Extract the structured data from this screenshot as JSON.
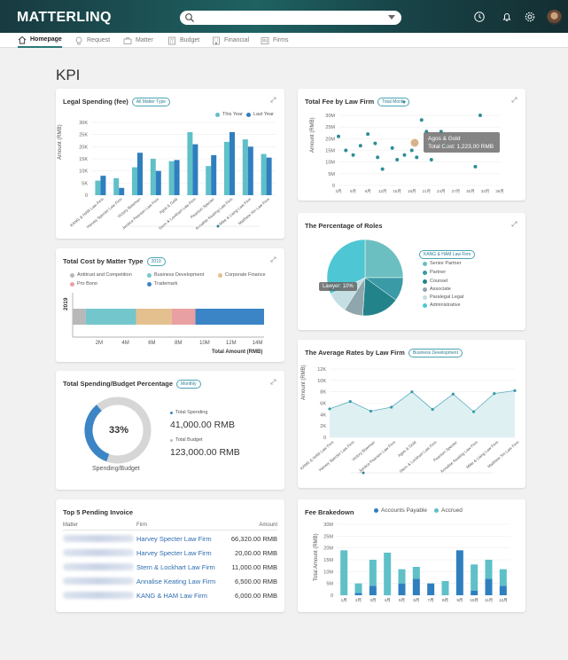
{
  "app": {
    "logo": "MATTERLINQ"
  },
  "search": {
    "placeholder": ""
  },
  "nav": [
    {
      "label": "Homepage",
      "icon": "home-icon"
    },
    {
      "label": "Request",
      "icon": "lightbulb-icon"
    },
    {
      "label": "Matter",
      "icon": "briefcase-icon"
    },
    {
      "label": "Budget",
      "icon": "calculator-icon"
    },
    {
      "label": "Financial",
      "icon": "building-icon"
    },
    {
      "label": "Firms",
      "icon": "contacts-icon"
    }
  ],
  "page_title": "KPI",
  "legal_spending": {
    "title": "Legal Spending (fee)",
    "filter": "All Matter Type",
    "legend": [
      "This Year",
      "Last Year"
    ],
    "ylabel": "Amount (RMB)",
    "colors": {
      "this_year": "#5fc0c8",
      "last_year": "#2f7fbf"
    }
  },
  "total_fee": {
    "title": "Total Fee by Law Firm",
    "filter": "Total Month",
    "ylabel": "Amount (RMB)",
    "tooltip_name": "Agos & Gold",
    "tooltip_value": "Total Cost: 1,223,00 RMB"
  },
  "cost_matter": {
    "title": "Total Cost by Matter Type",
    "filter": "2019",
    "legend": [
      "Antitrust and Competition",
      "Business Development",
      "Corporate Finance",
      "Pro Bono",
      "Trademark"
    ],
    "year_label": "2019",
    "xlabel": "Total Amount (RMB)"
  },
  "roles": {
    "title": "The Percentage of Roles",
    "filter": "KANG & HAM Law Firm",
    "legend": [
      "Senior Partner",
      "Partner",
      "Counsel",
      "Associate",
      "Paralegal Legal",
      "Administrative"
    ],
    "tooltip": "Lawyer: 10%"
  },
  "spending_budget": {
    "title": "Total Spending/Budget Percentage",
    "filter": "Monthly",
    "percent": "33%",
    "caption": "Spending/Budget",
    "spending_label": "Total Spending",
    "spending_value": "41,000.00 RMB",
    "budget_label": "Total Budget",
    "budget_value": "123,000.00 RMB"
  },
  "avg_rates": {
    "title": "The Average Rates by Law Firm",
    "filter": "Business Development",
    "ylabel": "Amount (RMB)"
  },
  "invoice": {
    "title": "Top 5 Pending Invoice",
    "headers": {
      "matter": "Matter",
      "firm": "Firm",
      "amount": "Amount"
    },
    "rows": [
      {
        "firm": "Harvey Specter Law Firm",
        "amount": "66,320.00 RMB"
      },
      {
        "firm": "Harvey Specter Law Firm",
        "amount": "20,00.00 RMB"
      },
      {
        "firm": "Stern & Lockhart Law Firm",
        "amount": "11,000.00 RMB"
      },
      {
        "firm": "Annalise Keating Law Firm",
        "amount": "6,500.00 RMB"
      },
      {
        "firm": "KANG & HAM Law Firm",
        "amount": "6,000.00 RMB"
      }
    ]
  },
  "fee_breakdown": {
    "title": "Fee Brakedown",
    "legend": [
      "Accounts Payable",
      "Accrued"
    ],
    "ylabel": "Total Amount (RMB)"
  },
  "chart_data": [
    {
      "type": "bar",
      "id": "legal_spending",
      "categories": [
        "KANG & HAM Law Firm",
        "Harvey Specter Law Firm",
        "Victory Bowman",
        "Jessica Pearson Law Firm",
        "Agos & Gold",
        "Stern & Lockhart Law Firm",
        "Pearson Specter",
        "Annalise Keating Law Firm",
        "Mike & Liang Law Firm",
        "Matthew Xin Law Firm"
      ],
      "series": [
        {
          "name": "This Year",
          "values": [
            6,
            7,
            11.5,
            15,
            14,
            26,
            12,
            22,
            23,
            17
          ]
        },
        {
          "name": "Last Year",
          "values": [
            8,
            3,
            17.5,
            10,
            14.5,
            21,
            16.5,
            26,
            20,
            15.5
          ]
        }
      ],
      "yticks": [
        "0",
        "5K",
        "10K",
        "15K",
        "20K",
        "25K",
        "30K"
      ],
      "ylim": [
        0,
        30
      ]
    },
    {
      "type": "scatter",
      "id": "total_fee",
      "xticks": [
        "3月",
        "6月",
        "9月",
        "12月",
        "15月",
        "18月",
        "21月",
        "24月",
        "27月",
        "30月",
        "33月",
        "36月"
      ],
      "yticks": [
        "0",
        "5M",
        "10M",
        "15M",
        "20M",
        "25M",
        "30M"
      ],
      "points": [
        [
          3,
          21
        ],
        [
          4.5,
          15
        ],
        [
          6,
          13
        ],
        [
          7.5,
          17
        ],
        [
          9,
          22
        ],
        [
          10.5,
          18
        ],
        [
          11,
          12
        ],
        [
          12,
          7
        ],
        [
          14,
          16
        ],
        [
          15,
          11
        ],
        [
          16.5,
          13
        ],
        [
          18,
          15
        ],
        [
          19,
          12
        ],
        [
          20,
          28
        ],
        [
          21,
          23
        ],
        [
          22,
          11
        ],
        [
          24,
          23
        ],
        [
          25,
          17
        ],
        [
          31,
          8
        ],
        [
          32,
          30
        ]
      ]
    },
    {
      "type": "bar",
      "id": "cost_matter",
      "orientation": "horizontal",
      "category": "2019",
      "xticks": [
        "2M",
        "4M",
        "6M",
        "8M",
        "10M",
        "12M",
        "14M"
      ],
      "segments": [
        {
          "name": "Antitrust and Competition",
          "value": 1,
          "color": "#b8b8b8"
        },
        {
          "name": "Business Development",
          "value": 3.8,
          "color": "#73c7cc"
        },
        {
          "name": "Corporate Finance",
          "value": 2.7,
          "color": "#e3c08e"
        },
        {
          "name": "Pro Bono",
          "value": 1.8,
          "color": "#e9a0a3"
        },
        {
          "name": "Trademark",
          "value": 5.2,
          "color": "#3b85c6"
        }
      ]
    },
    {
      "type": "pie",
      "id": "roles",
      "slices": [
        {
          "name": "Senior Partner",
          "value": 25,
          "color": "#6cbfc0"
        },
        {
          "name": "Partner",
          "value": 10,
          "color": "#3a9aa6"
        },
        {
          "name": "Counsel",
          "value": 16,
          "color": "#23838b"
        },
        {
          "name": "Associate",
          "value": 8,
          "color": "#8fa6ad"
        },
        {
          "name": "Paralegal Legal",
          "value": 9,
          "color": "#c3dfe3"
        },
        {
          "name": "Administrative",
          "value": 32,
          "color": "#4fc6d3"
        }
      ]
    },
    {
      "type": "pie",
      "id": "spending_budget",
      "slices": [
        {
          "name": "Total Spending",
          "value": 41000,
          "color": "#3b85c6"
        },
        {
          "name": "Remaining",
          "value": 82000,
          "color": "#d6d6d6"
        }
      ]
    },
    {
      "type": "area",
      "id": "avg_rates",
      "categories": [
        "KANG & HAM Law Firm",
        "Harvey Specter Law Firm",
        "Victory Bowman",
        "Jessica Pearson Law Firm",
        "Agos & Gold",
        "Stern & Lockhart Law Firm",
        "Pearson Specter",
        "Annalise Keating Law Firm",
        "Mike & Liang Law Firm",
        "Matthew Xin Law Firm"
      ],
      "values": [
        5000,
        6300,
        4600,
        5300,
        8000,
        4900,
        7600,
        4500,
        7700,
        8200
      ],
      "yticks": [
        "0",
        "2K",
        "4K",
        "6K",
        "8K",
        "10K",
        "12K"
      ],
      "ylim": [
        0,
        12000
      ]
    },
    {
      "type": "bar",
      "id": "fee_breakdown",
      "stacked": true,
      "categories": [
        "1月",
        "2月",
        "3月",
        "4月",
        "5月",
        "6月",
        "7月",
        "8月",
        "9月",
        "10月",
        "11月",
        "12月"
      ],
      "yticks": [
        "0",
        "5M",
        "10M",
        "15M",
        "20M",
        "25M",
        "30M"
      ],
      "series": [
        {
          "name": "Accounts Payable",
          "values": [
            0,
            1,
            4,
            0,
            5,
            7,
            5,
            0,
            19,
            2,
            7,
            4
          ]
        },
        {
          "name": "Accrued",
          "values": [
            19,
            4,
            11,
            18,
            6,
            5,
            0,
            6,
            0,
            11,
            8,
            7
          ]
        }
      ],
      "ylim": [
        0,
        30
      ]
    }
  ]
}
